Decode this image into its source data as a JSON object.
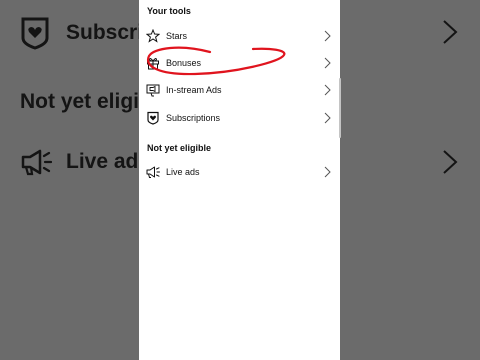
{
  "background": {
    "subscriptions_label": "Subscriptions",
    "not_eligible_heading": "Not yet eligible",
    "live_ads_label": "Live ads"
  },
  "panel": {
    "your_tools_title": "Your tools",
    "tools": [
      {
        "label": "Stars",
        "icon": "stars-icon"
      },
      {
        "label": "Bonuses",
        "icon": "gift-icon"
      },
      {
        "label": "In-stream Ads",
        "icon": "in-stream-ads-icon"
      },
      {
        "label": "Subscriptions",
        "icon": "subscriptions-icon"
      }
    ],
    "not_eligible_title": "Not yet eligible",
    "not_eligible_items": [
      {
        "label": "Live ads",
        "icon": "megaphone-icon"
      }
    ]
  },
  "colors": {
    "dim_background": "#6b6b6b",
    "panel": "#ffffff",
    "annotation": "#e0141e",
    "text": "#111111"
  }
}
